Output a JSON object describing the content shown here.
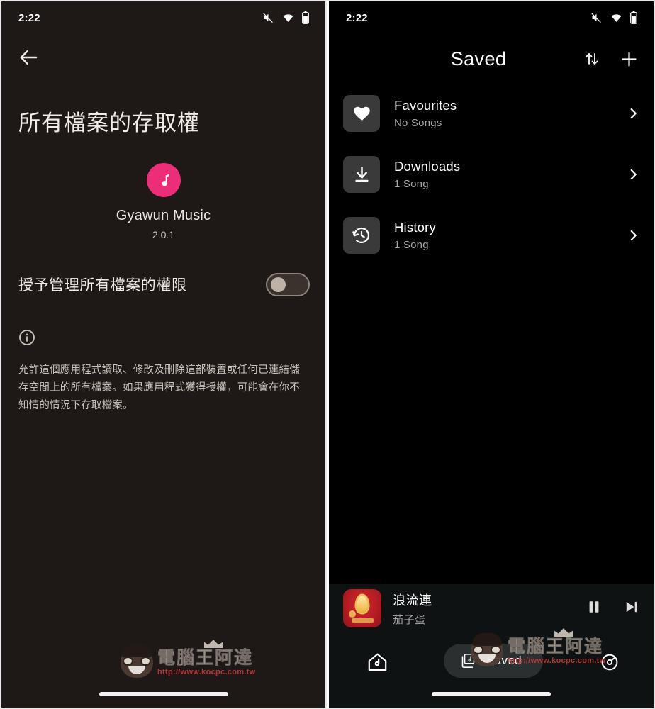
{
  "left_screen": {
    "status_bar": {
      "time": "2:22",
      "icons": [
        "mute-icon",
        "wifi-icon",
        "battery-icon"
      ]
    },
    "back_button_icon": "back-arrow-icon",
    "permission_title": "所有檔案的存取權",
    "app": {
      "icon": "music-note-icon",
      "icon_color": "#ec2e79",
      "name": "Gyawun Music",
      "version": "2.0.1"
    },
    "toggle": {
      "label": "授予管理所有檔案的權限",
      "state": "off"
    },
    "info_icon": "info-circle-icon",
    "description": "允許這個應用程式讀取、修改及刪除這部裝置或任何已連結儲存空間上的所有檔案。如果應用程式獲得授權，可能會在你不知情的情況下存取檔案。"
  },
  "right_screen": {
    "status_bar": {
      "time": "2:22",
      "icons": [
        "mute-icon",
        "wifi-icon",
        "battery-icon"
      ]
    },
    "header": {
      "title": "Saved",
      "sort_icon": "sort-arrows-icon",
      "add_icon": "plus-icon"
    },
    "list": [
      {
        "icon": "heart-icon",
        "title": "Favourites",
        "subtitle": "No Songs",
        "chevron": "chevron-right-icon"
      },
      {
        "icon": "download-icon",
        "title": "Downloads",
        "subtitle": "1 Song",
        "chevron": "chevron-right-icon"
      },
      {
        "icon": "history-icon",
        "title": "History",
        "subtitle": "1 Song",
        "chevron": "chevron-right-icon"
      }
    ],
    "player": {
      "album_art": "red-album-cover",
      "song_title": "浪流連",
      "artist": "茄子蛋",
      "pause_icon": "pause-icon",
      "next_icon": "next-track-icon"
    },
    "bottom_nav": {
      "home_icon": "home-music-icon",
      "saved_icon": "library-music-icon",
      "saved_label": "Saved",
      "settings_icon": "gear-icon"
    }
  },
  "watermark": {
    "brand": "電腦王阿達",
    "url": "http://www.kocpc.com.tw"
  }
}
